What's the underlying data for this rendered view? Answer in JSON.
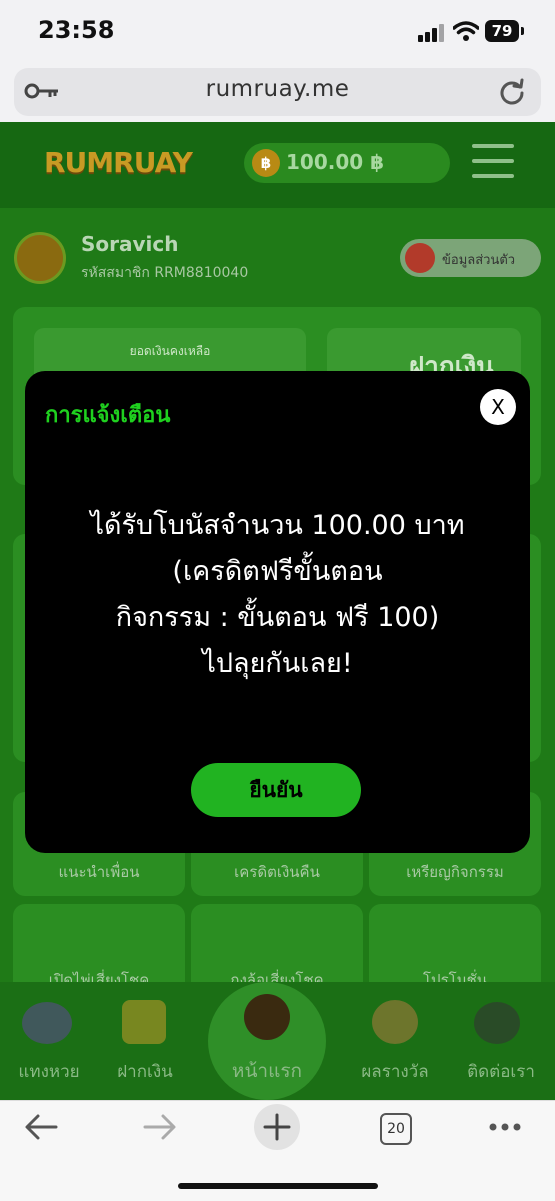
{
  "status_bar": {
    "time": "23:58",
    "battery": "79"
  },
  "browser": {
    "url": "rumruay.me",
    "tab_count": "20"
  },
  "site": {
    "logo": "RUMRUAY",
    "balance": "100.00 ฿",
    "coin_symbol": "฿",
    "user": {
      "name": "Soravich",
      "member_id": "รหัสสมาชิก RRM8810040"
    },
    "profile_button": "ข้อมูลส่วนตัว",
    "balance_card_label": "ยอดเงินคงเหลือ",
    "deposit_card_label": "ฝากเงิน",
    "grid_row1": [
      "แนะนำเพื่อน",
      "เครดิตเงินคืน",
      "เหรียญกิจกรรม"
    ],
    "grid_row2": [
      "เปิดไพ่เสี่ยงโชค",
      "กงล้อเสี่ยงโชค",
      "โปรโมชั่น"
    ],
    "bottom_nav": [
      "แทงหวย",
      "ฝากเงิน",
      "หน้าแรก",
      "ผลรางวัล",
      "ติดต่อเรา"
    ]
  },
  "modal": {
    "title": "การแจ้งเตือน",
    "close_label": "X",
    "message_lines": [
      "ได้รับโบนัสจำนวน 100.00 บาท",
      "(เครดิตฟรีขั้นตอน",
      "กิจกรรม : ขั้นตอน ฟรี 100)",
      "ไปลุยกันเลย!"
    ],
    "confirm_label": "ยืนยัน"
  },
  "colors": {
    "accent_green": "#1fd11f",
    "button_green": "#21b321",
    "page_green": "#1f7a17"
  }
}
